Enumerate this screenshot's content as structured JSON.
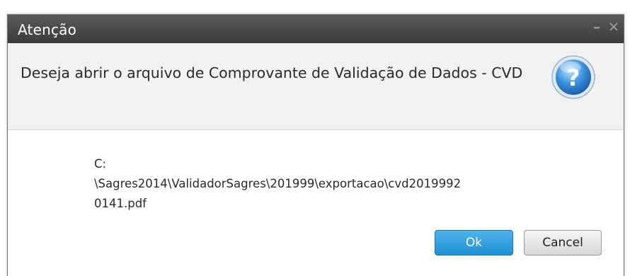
{
  "dialog": {
    "title": "Atenção",
    "minimize_glyph": "–",
    "close_glyph": "✕",
    "question": "Deseja abrir o arquivo de Comprovante de Validação de Dados - CVD",
    "help_icon": "question-icon",
    "file_path_lines": [
      "C:",
      "\\Sagres2014\\ValidadorSagres\\201999\\exportacao\\cvd2019992",
      "0141.pdf"
    ],
    "ok_label": "Ok",
    "cancel_label": "Cancel"
  },
  "colors": {
    "titlebar": "#4a4a4a",
    "header_bg": "#f1f1f1",
    "ok_button": "#2a9ade",
    "cancel_button": "#e3e3e3",
    "help_icon": "#3a8fd8"
  }
}
